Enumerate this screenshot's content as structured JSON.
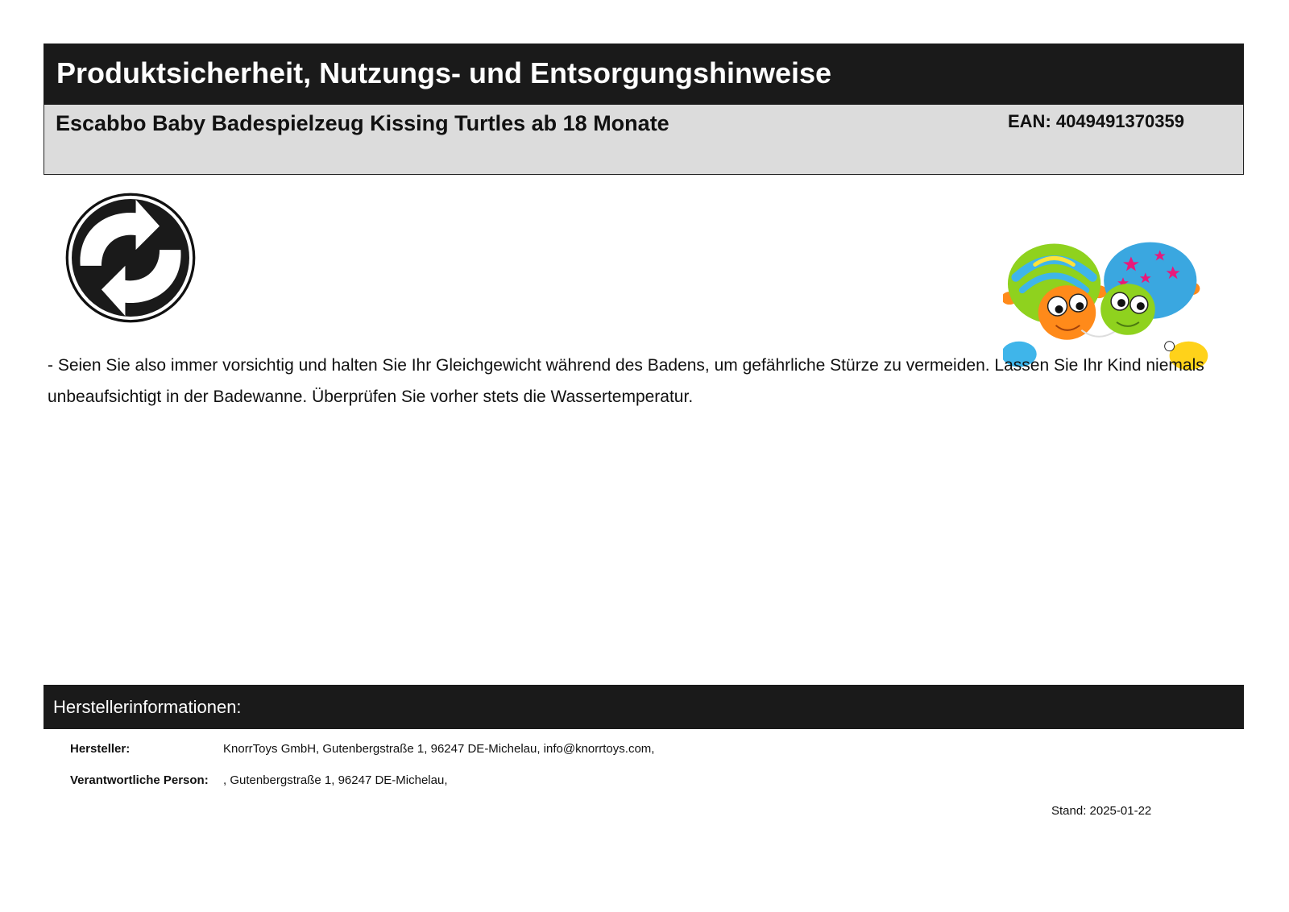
{
  "header": {
    "title": "Produktsicherheit, Nutzungs- und Entsorgungshinweise"
  },
  "product": {
    "name": "Escabbo Baby Badespielzeug Kissing Turtles ab 18 Monate",
    "ean": "EAN: 4049491370359"
  },
  "icons": {
    "recycle": "green-dot-recycling-icon",
    "product_image": "turtle-toy-image"
  },
  "notice": {
    "text": "- Seien Sie also immer vorsichtig und halten Sie Ihr Gleichgewicht während des Badens, um gefährliche Stürze zu vermeiden. Lassen Sie Ihr Kind niemals unbeaufsichtigt in der Badewanne. Überprüfen Sie vorher stets die Wassertemperatur."
  },
  "manufacturer": {
    "section_title": "Herstellerinformationen:",
    "rows": [
      {
        "label": "Hersteller:",
        "value": "KnorrToys GmbH, Gutenbergstraße 1, 96247 DE-Michelau, info@knorrtoys.com,"
      },
      {
        "label": "Verantwortliche Person:",
        "value": ", Gutenbergstraße 1, 96247 DE-Michelau,"
      }
    ]
  },
  "footer": {
    "stand": "Stand: 2025-01-22"
  },
  "colors": {
    "header_bg": "#1a1a1a",
    "product_bar_bg": "#dcdcdc",
    "turtle_green": "#8ed21e",
    "turtle_blue": "#3aa7e0",
    "turtle_orange": "#ff7f1a",
    "turtle_yellow": "#ffd21a"
  }
}
